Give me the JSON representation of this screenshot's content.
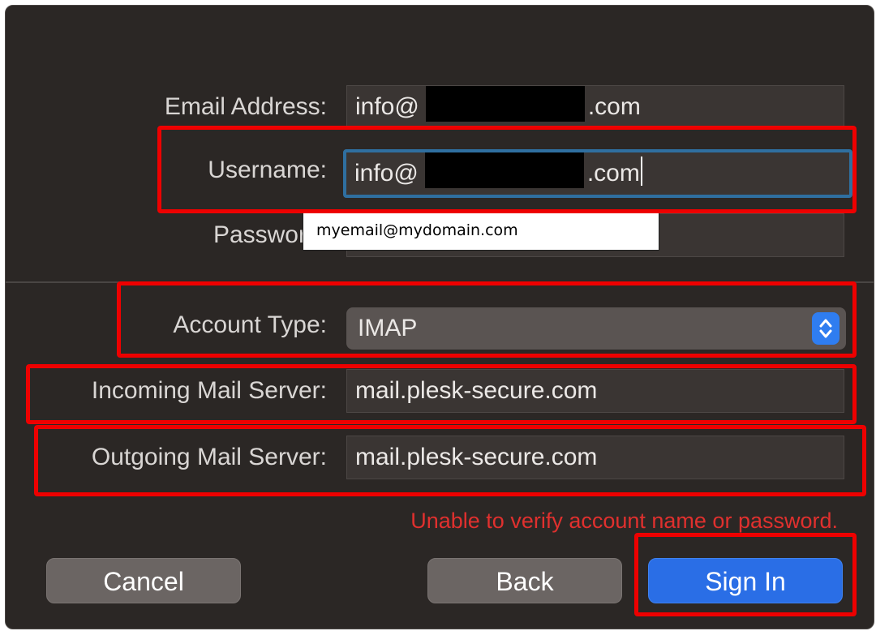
{
  "form": {
    "email_label": "Email Address:",
    "email_prefix": "info@",
    "email_suffix": ".com",
    "username_label": "Username:",
    "username_prefix": "info@",
    "username_suffix": ".com",
    "password_label": "Password:",
    "tooltip_text": "myemail@mydomain.com",
    "account_type_label": "Account Type:",
    "account_type_value": "IMAP",
    "incoming_label": "Incoming Mail Server:",
    "incoming_value": "mail.plesk-secure.com",
    "outgoing_label": "Outgoing Mail Server:",
    "outgoing_value": "mail.plesk-secure.com",
    "error_text": "Unable to verify account name or password."
  },
  "buttons": {
    "cancel": "Cancel",
    "back": "Back",
    "sign_in": "Sign In"
  },
  "icons": {
    "select_stepper": "up-down-chevron-icon"
  },
  "colors": {
    "annotation": "#ee0000",
    "error": "#e0302e",
    "primary_button": "#2a6ee6",
    "focus_ring": "#2f6fa0"
  }
}
